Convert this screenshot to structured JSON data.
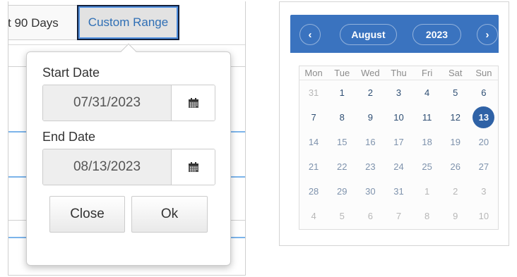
{
  "range_bar": {
    "tab_90": "t 90 Days",
    "tab_custom": "Custom Range"
  },
  "popover": {
    "start_label": "Start Date",
    "start_value": "07/31/2023",
    "end_label": "End Date",
    "end_value": "08/13/2023",
    "close_label": "Close",
    "ok_label": "Ok"
  },
  "calendar": {
    "prev_icon": "‹",
    "next_icon": "›",
    "month": "August",
    "year": "2023",
    "accent_color": "#3a73bf",
    "selected_color": "#2f62a6",
    "days_of_week": [
      "Mon",
      "Tue",
      "Wed",
      "Thu",
      "Fri",
      "Sat",
      "Sun"
    ],
    "weeks": [
      [
        "31",
        "1",
        "2",
        "3",
        "4",
        "5",
        "6"
      ],
      [
        "7",
        "8",
        "9",
        "10",
        "11",
        "12",
        "13"
      ],
      [
        "14",
        "15",
        "16",
        "17",
        "18",
        "19",
        "20"
      ],
      [
        "21",
        "22",
        "23",
        "24",
        "25",
        "26",
        "27"
      ],
      [
        "28",
        "29",
        "30",
        "31",
        "1",
        "2",
        "3"
      ],
      [
        "4",
        "5",
        "6",
        "7",
        "8",
        "9",
        "10"
      ]
    ],
    "selected_day": "13"
  }
}
